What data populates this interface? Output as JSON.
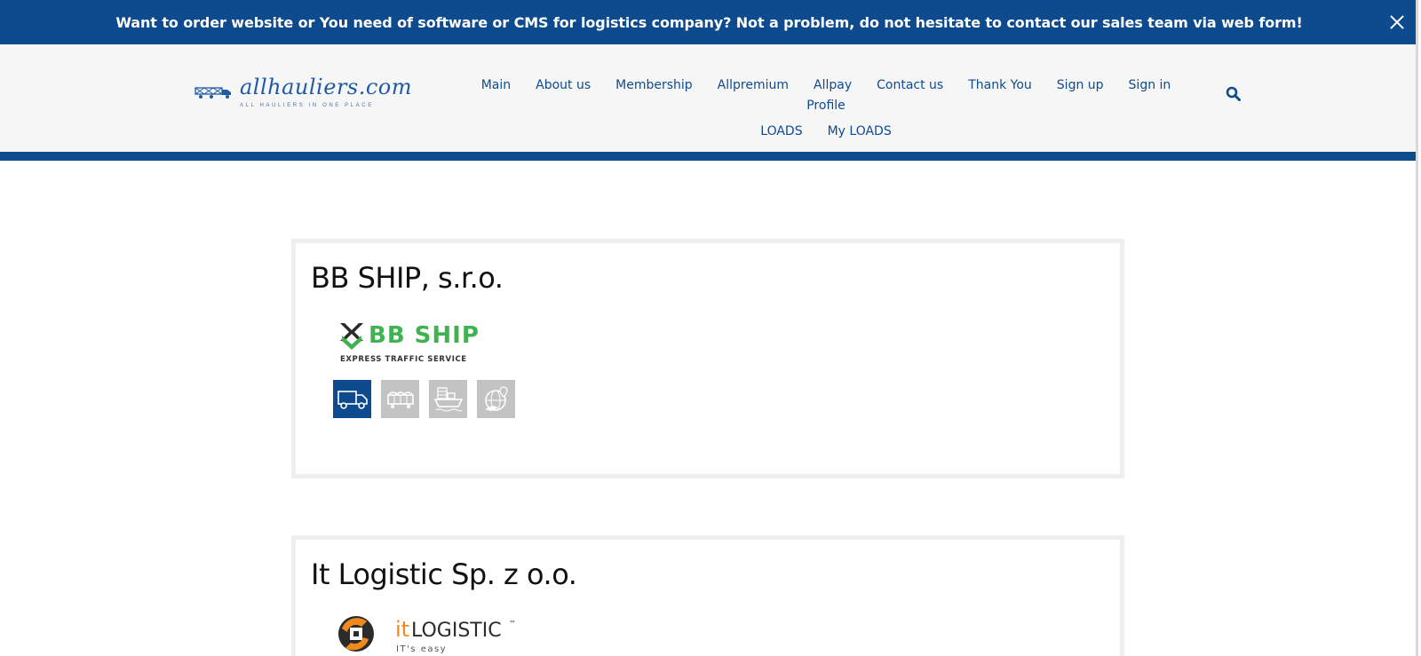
{
  "notice": {
    "text": "Want to order website or You need of software or CMS for logistics company? Not a problem, do not hesitate to contact our sales team via web form!"
  },
  "header": {
    "logo": {
      "wordmark": "allhauliers.com",
      "tagline": "ALL HAULIERS IN ONE PLACE"
    },
    "nav": {
      "row1": [
        "Main",
        "About us",
        "Membership",
        "Allpremium",
        "Allpay",
        "Contact us",
        "Thank You",
        "Sign up",
        "Sign in",
        "Profile"
      ],
      "row2": [
        "LOADS",
        "My LOADS"
      ]
    }
  },
  "companies": [
    {
      "name": "BB SHIP, s.r.o.",
      "logo": {
        "brand": "BB SHIP",
        "subtitle": "EXPRESS TRAFFIC SERVICE",
        "brand_color": "#3fb34f"
      },
      "services": [
        {
          "icon": "truck-icon",
          "active": true
        },
        {
          "icon": "rail-wagon-icon",
          "active": false
        },
        {
          "icon": "ship-icon",
          "active": false
        },
        {
          "icon": "globe-plane-icon",
          "active": false
        }
      ]
    },
    {
      "name": "It Logistic Sp. z o.o.",
      "logo": {
        "brand_prefix": "it",
        "brand": "LOGISTIC",
        "tm": "™",
        "tagline": "IT's easy",
        "accent": "#f08a1c"
      }
    }
  ],
  "colors": {
    "primary": "#0d4b8e",
    "header_bg": "#f7f6f7",
    "card_border": "#efefef",
    "inactive_service": "#c3c3c3"
  }
}
